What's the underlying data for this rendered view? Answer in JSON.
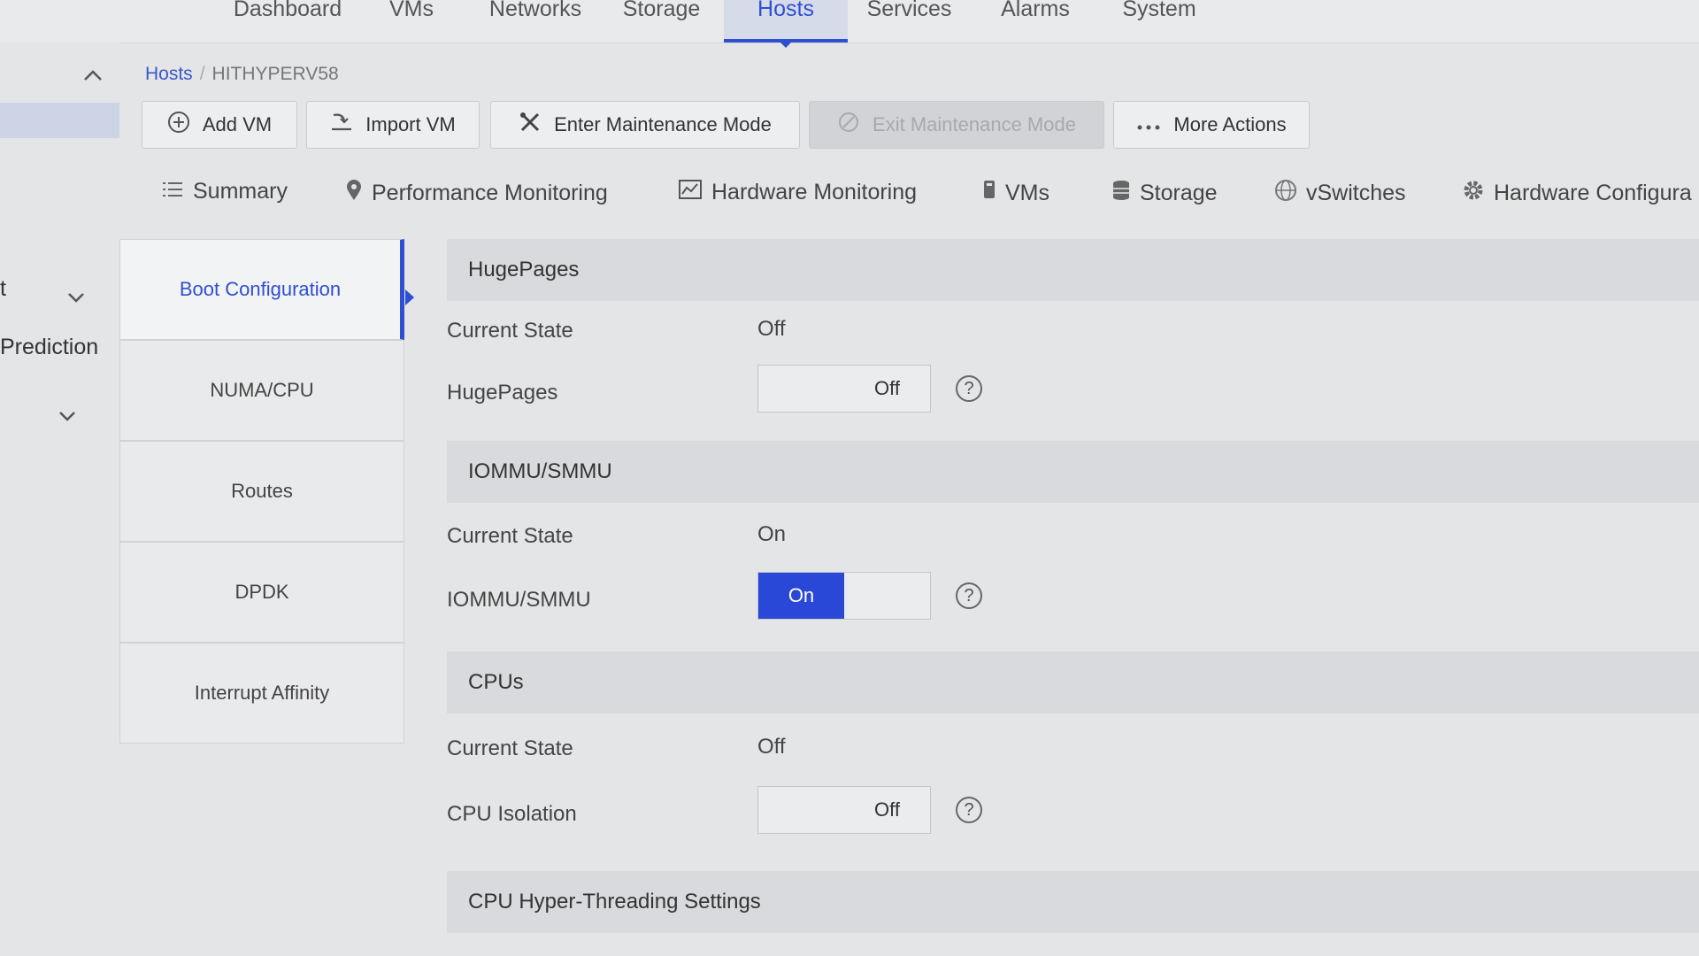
{
  "top_nav": {
    "tabs": [
      {
        "label": "Dashboard"
      },
      {
        "label": "VMs"
      },
      {
        "label": "Networks"
      },
      {
        "label": "Storage"
      },
      {
        "label": "Hosts",
        "active": true
      },
      {
        "label": "Services"
      },
      {
        "label": "Alarms"
      },
      {
        "label": "System"
      }
    ]
  },
  "left_rail": {
    "collapse_icon": "chevron-up-icon",
    "item_1_label": "t",
    "item_1_icon": "chevron-down-icon",
    "item_2_label": "Prediction",
    "item_3_icon": "chevron-down-icon"
  },
  "breadcrumb": {
    "root": "Hosts",
    "separator": "/",
    "current": "HITHYPERV58"
  },
  "toolbar": {
    "add_vm": "Add VM",
    "import_vm": "Import VM",
    "enter_maintenance": "Enter Maintenance Mode",
    "exit_maintenance": "Exit Maintenance Mode",
    "more_actions": "More Actions"
  },
  "subtabs": [
    {
      "label": "Summary",
      "icon": "list-icon"
    },
    {
      "label": "Performance Monitoring",
      "icon": "location-pin-icon"
    },
    {
      "label": "Hardware Monitoring",
      "icon": "chart-icon"
    },
    {
      "label": "VMs",
      "icon": "vm-icon"
    },
    {
      "label": "Storage",
      "icon": "database-icon"
    },
    {
      "label": "vSwitches",
      "icon": "globe-icon"
    },
    {
      "label": "Hardware Configura",
      "icon": "gear-icon"
    }
  ],
  "side_menu": [
    {
      "label": "Boot Configuration",
      "active": true
    },
    {
      "label": "NUMA/CPU"
    },
    {
      "label": "Routes"
    },
    {
      "label": "DPDK"
    },
    {
      "label": "Interrupt Affinity"
    }
  ],
  "sections": {
    "hugepages": {
      "title": "HugePages",
      "current_state_label": "Current State",
      "current_state_value": "Off",
      "setting_label": "HugePages",
      "toggle_value": "Off"
    },
    "iommu": {
      "title": "IOMMU/SMMU",
      "current_state_label": "Current State",
      "current_state_value": "On",
      "setting_label": "IOMMU/SMMU",
      "toggle_value": "On"
    },
    "cpus": {
      "title": "CPUs",
      "current_state_label": "Current State",
      "current_state_value": "Off",
      "setting_label": "CPU Isolation",
      "toggle_value": "Off"
    },
    "hyperthreading": {
      "title": "CPU Hyper-Threading Settings"
    }
  },
  "help_icon": "?",
  "colors": {
    "accent": "#2f4fd0",
    "toggle_on": "#2a48d8"
  }
}
